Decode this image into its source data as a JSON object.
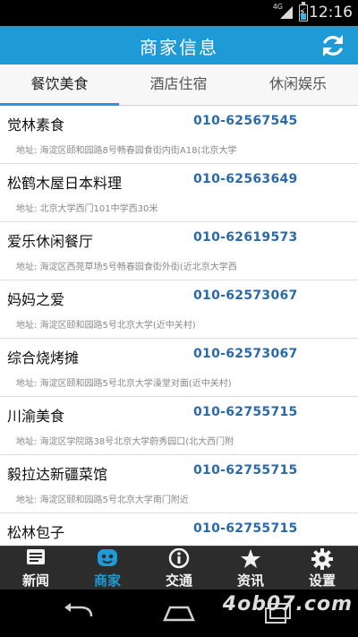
{
  "status_bar": {
    "time": "12:16",
    "network": "4G",
    "icons": [
      "signal-icon",
      "battery-charging-icon"
    ]
  },
  "header": {
    "title": "商家信息",
    "refresh_icon": "refresh-icon"
  },
  "tabs": [
    {
      "label": "餐饮美食",
      "active": true
    },
    {
      "label": "酒店住宿",
      "active": false
    },
    {
      "label": "休闲娱乐",
      "active": false
    }
  ],
  "merchants": [
    {
      "name": "觉林素食",
      "phone": "010-62567545",
      "address": "地址: 海淀区颐和园路8号畅春园食街内街A18(北京大学"
    },
    {
      "name": "松鹤木屋日本料理",
      "phone": "010-62563649",
      "address": "地址: 北京大学西门101中学西30米"
    },
    {
      "name": "爱乐休闲餐厅",
      "phone": "010-62619573",
      "address": "地址: 海淀区西苑草场5号畅春园食街外街(近北京大学西"
    },
    {
      "name": "妈妈之爱",
      "phone": "010-62573067",
      "address": "地址: 海淀区颐和园路5号北京大学(近中关村)"
    },
    {
      "name": "综合烧烤摊",
      "phone": "010-62573067",
      "address": "地址: 海淀区颐和园路5号北京大学澡堂对面(近中关村)"
    },
    {
      "name": "川渝美食",
      "phone": "010-62755715",
      "address": "地址: 海淀区学院路38号北京大学蔚秀园口(北大西门附"
    },
    {
      "name": "毅拉达新疆菜馆",
      "phone": "010-62755715",
      "address": "地址: 海淀区颐和园路5号北京大学南门附近"
    },
    {
      "name": "松林包子",
      "phone": "010-62755715",
      "address": ""
    }
  ],
  "bottom_nav": [
    {
      "label": "新闻",
      "icon": "news-icon",
      "active": false
    },
    {
      "label": "商家",
      "icon": "merchant-face-icon",
      "active": true
    },
    {
      "label": "交通",
      "icon": "info-icon",
      "active": false
    },
    {
      "label": "资讯",
      "icon": "star-icon",
      "active": false
    },
    {
      "label": "设置",
      "icon": "gear-icon",
      "active": false
    }
  ],
  "system_nav": {
    "icons": [
      "back-icon",
      "home-icon",
      "recents-icon"
    ],
    "watermark": "4ob07.com"
  },
  "colors": {
    "accent": "#1e9bd6",
    "phone": "#2a6aa8",
    "nav_bg": "#2c2c2c"
  }
}
